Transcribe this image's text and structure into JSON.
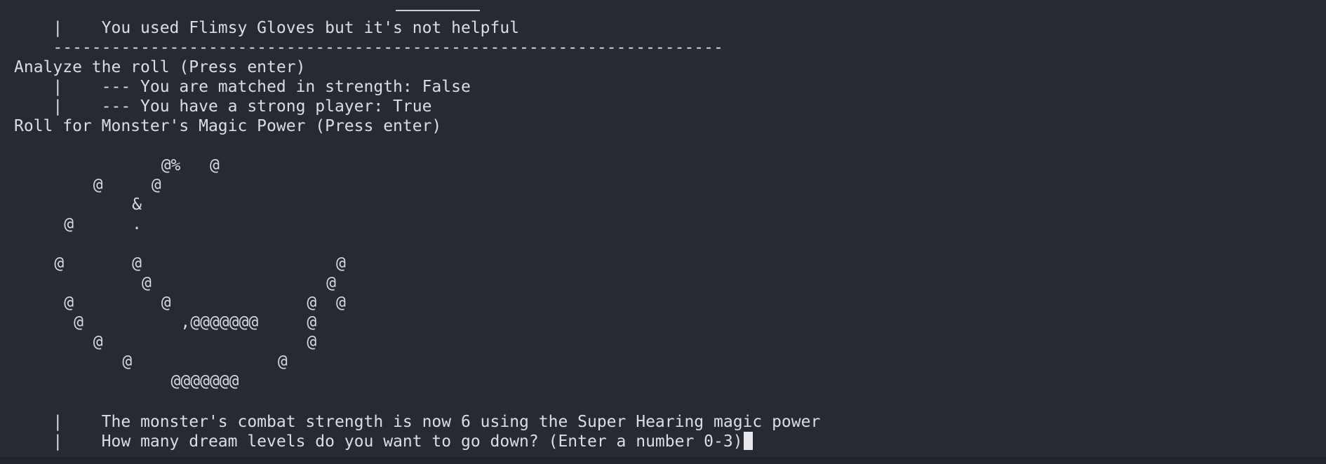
{
  "terminal": {
    "lines": [
      "    |    You used Flimsy Gloves but it's not helpful",
      "    ---------------------------------------------------------------------",
      "Analyze the roll (Press enter)",
      "    |    --- You are matched in strength: False",
      "    |    --- You have a strong player: True",
      "Roll for Monster's Magic Power (Press enter)"
    ],
    "ascii_art": "               @%   @\n        @     @\n            &\n     @      .\n\n    @       @                    @\n             @                  @\n     @         @              @  @\n      @          ,@@@@@@@     @\n        @                     @\n           @               @\n                @@@@@@@",
    "result_line": "    |    The monster's combat strength is now 6 using the Super Hearing magic power",
    "prompt_line": "    |    How many dream levels do you want to go down? (Enter a number 0-3)"
  }
}
